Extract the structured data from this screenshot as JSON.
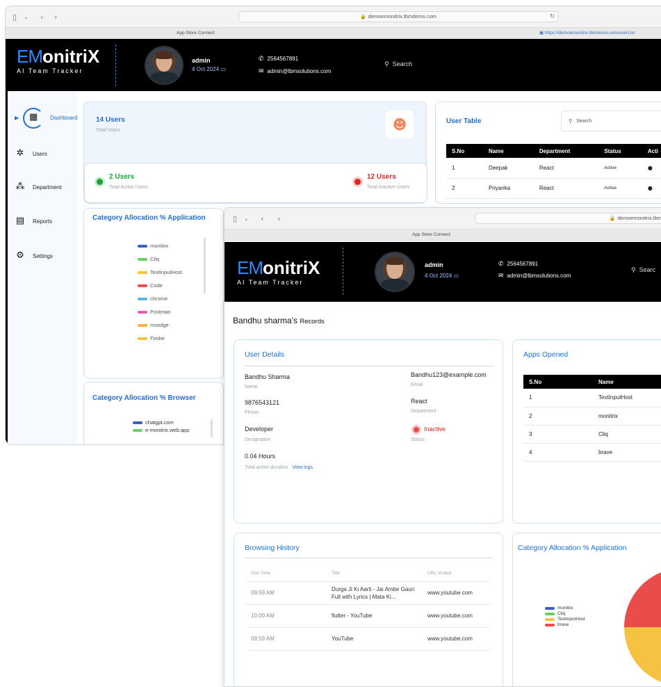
{
  "back_window": {
    "url": "demoemonitrix.lbmdemo.com",
    "tab_left": "App Store Connect",
    "tab_right": "https://demoemonitrix.lbmdemo.com/userList",
    "logo": {
      "em": "EM",
      "rest": "onitriX",
      "sub": "AI Team Tracker"
    },
    "user": {
      "name": "admin",
      "date": "4 Oct 2024"
    },
    "contact": {
      "phone": "2564567891",
      "email": "admin@lbmsolutions.com"
    },
    "search_placeholder": "Search",
    "sidebar": [
      {
        "label": "Dashboard",
        "icon": "building-icon"
      },
      {
        "label": "Users",
        "icon": "users-icon"
      },
      {
        "label": "Department",
        "icon": "org-chart-icon"
      },
      {
        "label": "Reports",
        "icon": "report-icon"
      },
      {
        "label": "Settings",
        "icon": "gear-icon"
      }
    ],
    "total_users": {
      "value": "14 Users",
      "label": "Total Users"
    },
    "active_users": {
      "value": "2 Users",
      "label": "Total Active Users"
    },
    "inactive_users": {
      "value": "12 Users",
      "label": "Total Inactive Users"
    },
    "user_table": {
      "title": "User Table",
      "search_placeholder": "Search",
      "headers": [
        "S.No",
        "Name",
        "Department",
        "Status",
        "Acti"
      ],
      "rows": [
        {
          "sno": "1",
          "name": "Deepak",
          "dept": "React",
          "status": "Active"
        },
        {
          "sno": "2",
          "name": "Priyanka",
          "dept": "React",
          "status": "Active"
        }
      ]
    },
    "category_app": {
      "title": "Category Allocation % Application",
      "legend": [
        {
          "name": "monitrix",
          "color": "#3b5fc9"
        },
        {
          "name": "Cliq",
          "color": "#6bcf63"
        },
        {
          "name": "TextInputHost",
          "color": "#f5c242"
        },
        {
          "name": "Code",
          "color": "#ea4c4c"
        },
        {
          "name": "chrome",
          "color": "#5ab8e6"
        },
        {
          "name": "Postman",
          "color": "#e85ab5"
        },
        {
          "name": "msedge",
          "color": "#f5b142"
        },
        {
          "name": "Finder",
          "color": "#f5c242"
        }
      ]
    },
    "category_browser": {
      "title": "Category Allocation % Browser",
      "legend": [
        {
          "name": "chatgpt.com",
          "color": "#3b5fc9"
        },
        {
          "name": "e-monitrix.web.app",
          "color": "#6bcf63"
        }
      ]
    }
  },
  "front_window": {
    "url": "demoemonitrix.lbm",
    "tab": "App Store Connect",
    "logo": {
      "em": "EM",
      "rest": "onitriX",
      "sub": "AI Team Tracker"
    },
    "user": {
      "name": "admin",
      "date": "4 Oct 2024"
    },
    "contact": {
      "phone": "2564567891",
      "email": "admin@lbmsolutions.com"
    },
    "search_placeholder": "Searc",
    "records_title_name": "Bandhu sharma's",
    "records_title_suffix": "Records",
    "user_details": {
      "title": "User Details",
      "name": {
        "value": "Bandhu Sharma",
        "label": "Name"
      },
      "email": {
        "value": "Bandhu123@example.com",
        "label": "Email"
      },
      "phone": {
        "value": "9876543121",
        "label": "Phone"
      },
      "department": {
        "value": "React",
        "label": "Department"
      },
      "designation": {
        "value": "Developer",
        "label": "Designation"
      },
      "status": {
        "value": "Inactive",
        "label": "Status"
      },
      "duration": {
        "value": "0.04 Hours",
        "label": "Total active duration",
        "link": "View logs"
      }
    },
    "apps_opened": {
      "title": "Apps Opened",
      "headers": [
        "S.No",
        "Name"
      ],
      "rows": [
        {
          "sno": "1",
          "name": "TextInputHost"
        },
        {
          "sno": "2",
          "name": "monitrix"
        },
        {
          "sno": "3",
          "name": "Cliq"
        },
        {
          "sno": "4",
          "name": "brave"
        }
      ]
    },
    "browsing_history": {
      "title": "Browsing History",
      "headers": [
        "Visit Time",
        "Title",
        "URL Visited"
      ],
      "rows": [
        {
          "time": "09:59 AM",
          "title": "Durga Ji Ki Aarti - Jai Ambe Gauri Full with Lyrics | Mata Ki...",
          "url": "www.youtube.com"
        },
        {
          "time": "10:00 AM",
          "title": "flutter - YouTube",
          "url": "www.youtube.com"
        },
        {
          "time": "09:59 AM",
          "title": "YouTube",
          "url": "www.youtube.com"
        }
      ]
    },
    "category_app": {
      "title": "Category Allocation % Application",
      "legend": [
        {
          "name": "monitrix",
          "color": "#3b5fc9"
        },
        {
          "name": "Cliq",
          "color": "#6bcf63"
        },
        {
          "name": "TextInputHost",
          "color": "#f5c242"
        },
        {
          "name": "brave",
          "color": "#ea4c4c"
        }
      ]
    }
  }
}
